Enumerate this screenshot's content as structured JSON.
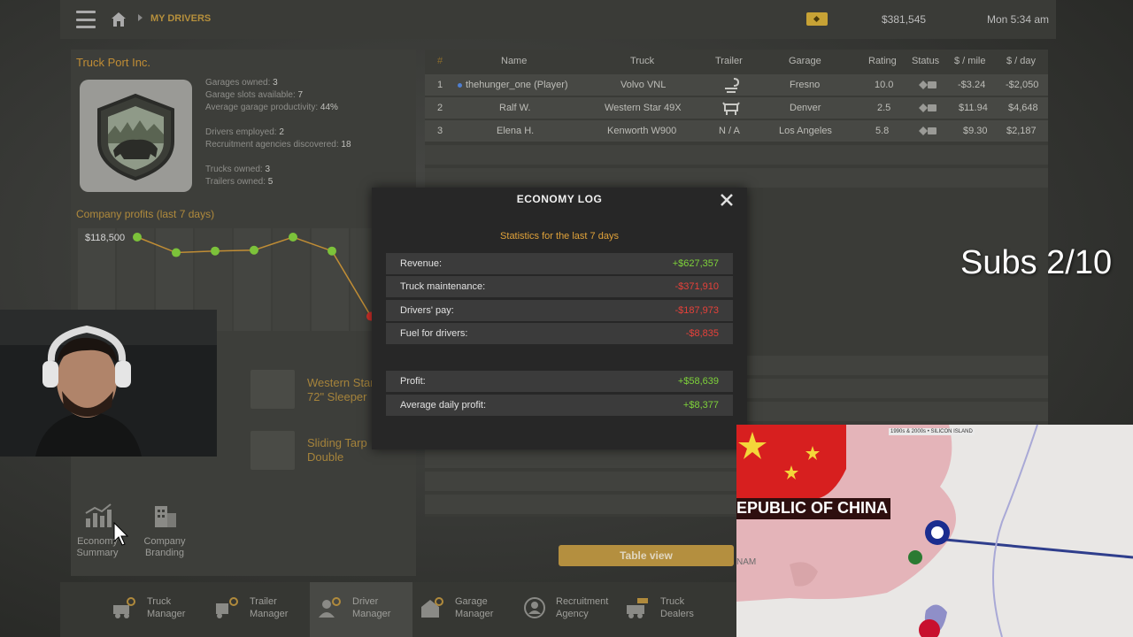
{
  "topbar": {
    "breadcrumb": "MY DRIVERS",
    "balance": "$381,545",
    "clock": "Mon 5:34 am"
  },
  "company": {
    "name": "Truck Port Inc.",
    "stats": [
      {
        "label": "Garages owned:",
        "value": "3"
      },
      {
        "label": "Garage slots available:",
        "value": "7"
      },
      {
        "label": "Average garage productivity:",
        "value": "44%"
      },
      {
        "label": "Drivers employed:",
        "value": "2"
      },
      {
        "label": "Recruitment agencies discovered:",
        "value": "18"
      },
      {
        "label": "Trucks owned:",
        "value": "3"
      },
      {
        "label": "Trailers owned:",
        "value": "5"
      }
    ],
    "profits_title": "Company profits (last 7 days)",
    "profits_label": "$118,500"
  },
  "chart_data": {
    "type": "line",
    "title": "Company profits (last 7 days)",
    "values": [
      118500,
      109000,
      110000,
      110500,
      118500,
      110000,
      70000
    ],
    "ylim": [
      60000,
      125000
    ],
    "color": "#c08d35"
  },
  "vehicles": [
    {
      "line1": "Western Star",
      "line2": "72\" Sleeper"
    },
    {
      "line1": "Sliding Tarp",
      "line2": "Double"
    }
  ],
  "bottom_icons": [
    {
      "line1": "Economy",
      "line2": "Summary"
    },
    {
      "line1": "Company",
      "line2": "Branding"
    }
  ],
  "table": {
    "headers": [
      "#",
      "Name",
      "Truck",
      "Trailer",
      "Garage",
      "Rating",
      "Status",
      "$ / mile",
      "$ / day"
    ],
    "rows": [
      {
        "num": "1",
        "name": "thehunger_one (Player)",
        "truck": "Volvo VNL",
        "trailer": "",
        "garage": "Fresno",
        "rating": "10.0",
        "per_mile": "-$3.24",
        "per_day": "-$2,050"
      },
      {
        "num": "2",
        "name": "Ralf W.",
        "truck": "Western Star 49X",
        "trailer": "",
        "garage": "Denver",
        "rating": "2.5",
        "per_mile": "$11.94",
        "per_day": "$4,648"
      },
      {
        "num": "3",
        "name": "Elena H.",
        "truck": "Kenworth W900",
        "trailer": "N / A",
        "garage": "Los Angeles",
        "rating": "5.8",
        "per_mile": "$9.30",
        "per_day": "$2,187"
      }
    ],
    "view_button": "Table view"
  },
  "modal": {
    "title": "ECONOMY LOG",
    "subtitle": "Statistics for the last 7 days",
    "rows": [
      {
        "label": "Revenue:",
        "value": "+$627,357"
      },
      {
        "label": "Truck maintenance:",
        "value": "-$371,910"
      },
      {
        "label": "Drivers' pay:",
        "value": "-$187,973"
      },
      {
        "label": "Fuel for drivers:",
        "value": "-$8,835"
      }
    ],
    "summary": [
      {
        "label": "Profit:",
        "value": "+$58,639"
      },
      {
        "label": "Average daily profit:",
        "value": "+$8,377"
      }
    ]
  },
  "nav": [
    {
      "line1": "Truck",
      "line2": "Manager"
    },
    {
      "line1": "Trailer",
      "line2": "Manager"
    },
    {
      "line1": "Driver",
      "line2": "Manager"
    },
    {
      "line1": "Garage",
      "line2": "Manager"
    },
    {
      "line1": "Recruitment",
      "line2": "Agency"
    },
    {
      "line1": "Truck",
      "line2": "Dealers"
    }
  ],
  "overlay": {
    "subs": "Subs 2/10",
    "map_banner": "EPUBLIC OF CHINA",
    "map_tag": "1990s & 2000s • SILICON ISLAND",
    "map_side": "NAM"
  }
}
